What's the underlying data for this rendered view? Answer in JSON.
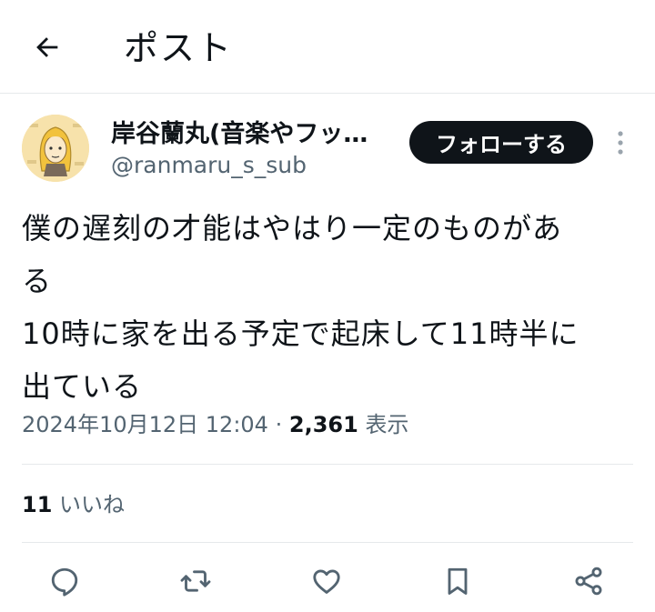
{
  "header": {
    "back_icon": "arrow-left-icon",
    "title": "ポスト"
  },
  "author": {
    "avatar_icon": "avatar-illustration",
    "name": "岸谷蘭丸(音楽やフッ…",
    "handle": "@ranmaru_s_sub",
    "follow_label": "フォローする",
    "more_icon": "more-vertical-icon"
  },
  "post": {
    "text": "僕の遅刻の才能はやはり一定のものがあ\nる\n10時に家を出る予定で起床して11時半に\n出ている",
    "timestamp": "2024年10月12日 12:04",
    "separator": "·",
    "views_count": "2,361",
    "views_label": "表示"
  },
  "stats": {
    "likes_count": "11",
    "likes_label": "いいね"
  },
  "actions": [
    {
      "name": "reply",
      "icon": "reply-icon"
    },
    {
      "name": "repost",
      "icon": "repost-icon"
    },
    {
      "name": "like",
      "icon": "heart-icon"
    },
    {
      "name": "bookmark",
      "icon": "bookmark-icon"
    },
    {
      "name": "share",
      "icon": "share-icon"
    }
  ],
  "colors": {
    "text": "#0f1419",
    "secondary": "#536471",
    "divider": "#e6e9eb",
    "button_bg": "#0f1419"
  }
}
